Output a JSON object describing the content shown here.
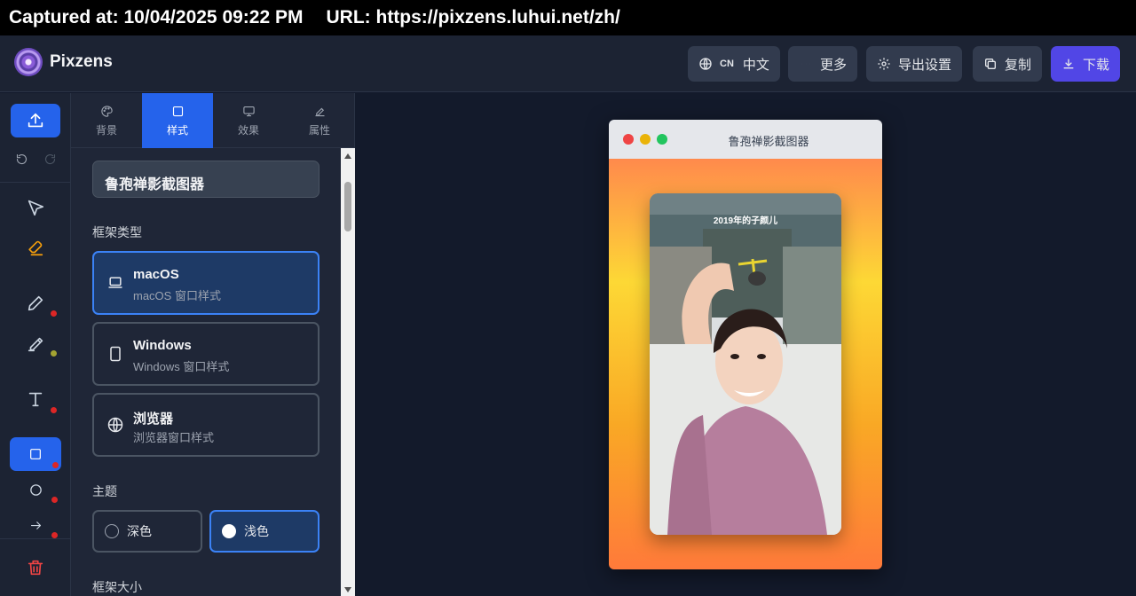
{
  "capture": {
    "text": "Captured at: 10/04/2025 09:22 PM",
    "url": "URL: https://pixzens.luhui.net/zh/"
  },
  "header": {
    "brand": "Pixzens",
    "lang_code": "CN",
    "lang_label": "中文",
    "more_label": "更多",
    "export_settings_label": "导出设置",
    "copy_label": "复制",
    "download_label": "下载"
  },
  "toolbar": {
    "tools": [
      "upload",
      "undo",
      "redo",
      "select",
      "eraser",
      "pen",
      "highlighter",
      "text",
      "rectangle",
      "circle",
      "arrow",
      "delete"
    ],
    "active_tool": "rectangle",
    "colors": {
      "accent": "#2563eb",
      "dot_red": "#dc2626",
      "dot_olive": "#a3a332",
      "eraser": "#f59e0b",
      "delete": "#ef4444"
    }
  },
  "panel": {
    "tabs": [
      {
        "label": "背景",
        "icon": "palette-icon"
      },
      {
        "label": "样式",
        "icon": "square-icon"
      },
      {
        "label": "效果",
        "icon": "monitor-icon"
      },
      {
        "label": "属性",
        "icon": "edit-icon"
      }
    ],
    "active_tab": "样式",
    "window_title_value": "鲁孢禅影截图器",
    "frame_type_label": "框架类型",
    "frames": [
      {
        "name": "macOS",
        "desc": "macOS 窗口样式",
        "icon": "laptop-icon"
      },
      {
        "name": "Windows",
        "desc": "Windows 窗口样式",
        "icon": "tablet-icon"
      },
      {
        "name": "浏览器",
        "desc": "浏览器窗口样式",
        "icon": "globe-icon"
      }
    ],
    "selected_frame": "macOS",
    "theme_label": "主题",
    "themes": [
      "深色",
      "浅色"
    ],
    "selected_theme": "浅色",
    "frame_size_label": "框架大小"
  },
  "preview": {
    "window_title": "鲁孢禅影截图器",
    "photo_caption": "2019年的子颜儿",
    "gradient": [
      "#ff8a4c",
      "#fdd835",
      "#f9a825",
      "#ff7a3a"
    ]
  }
}
